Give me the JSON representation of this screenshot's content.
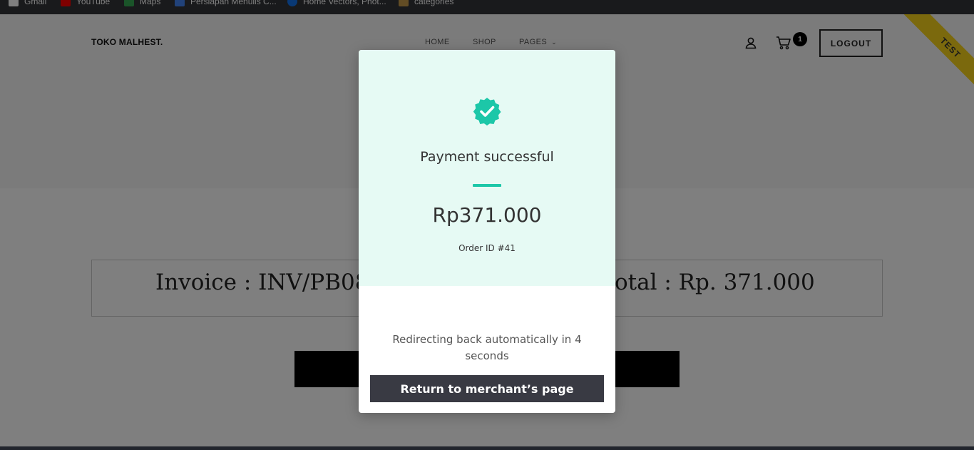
{
  "bookmarks": [
    {
      "label": "Gmail",
      "icon": "gmail-icon",
      "color": "#ffffff"
    },
    {
      "label": "YouTube",
      "icon": "youtube-icon",
      "color": "#ff0000"
    },
    {
      "label": "Maps",
      "icon": "maps-icon",
      "color": "#34a853"
    },
    {
      "label": "Persiapan Menulis C...",
      "icon": "bookmark-icon",
      "color": "#4285f4"
    },
    {
      "label": "Home Vectors, Phot...",
      "icon": "freepik-icon",
      "color": "#1273eb"
    },
    {
      "label": "categories",
      "icon": "site-icon",
      "color": "#c69a4a"
    }
  ],
  "header": {
    "brand": "TOKO MALHEST.",
    "nav": [
      "HOME",
      "SHOP",
      "PAGES"
    ],
    "cart_count": "1",
    "logout_label": "LOGOUT",
    "ribbon": "TEST"
  },
  "invoice": {
    "left_text": "Invoice : INV/PB08R",
    "right_text": "otal : Rp. 371.000"
  },
  "modal": {
    "title": "Payment successful",
    "amount": "Rp371.000",
    "order_id": "Order ID #41",
    "redirect_text": "Redirecting back automatically in 4 seconds",
    "button_label": "Return to merchant’s page",
    "accent": "#1cc7a8",
    "top_bg": "#e6faf4"
  }
}
